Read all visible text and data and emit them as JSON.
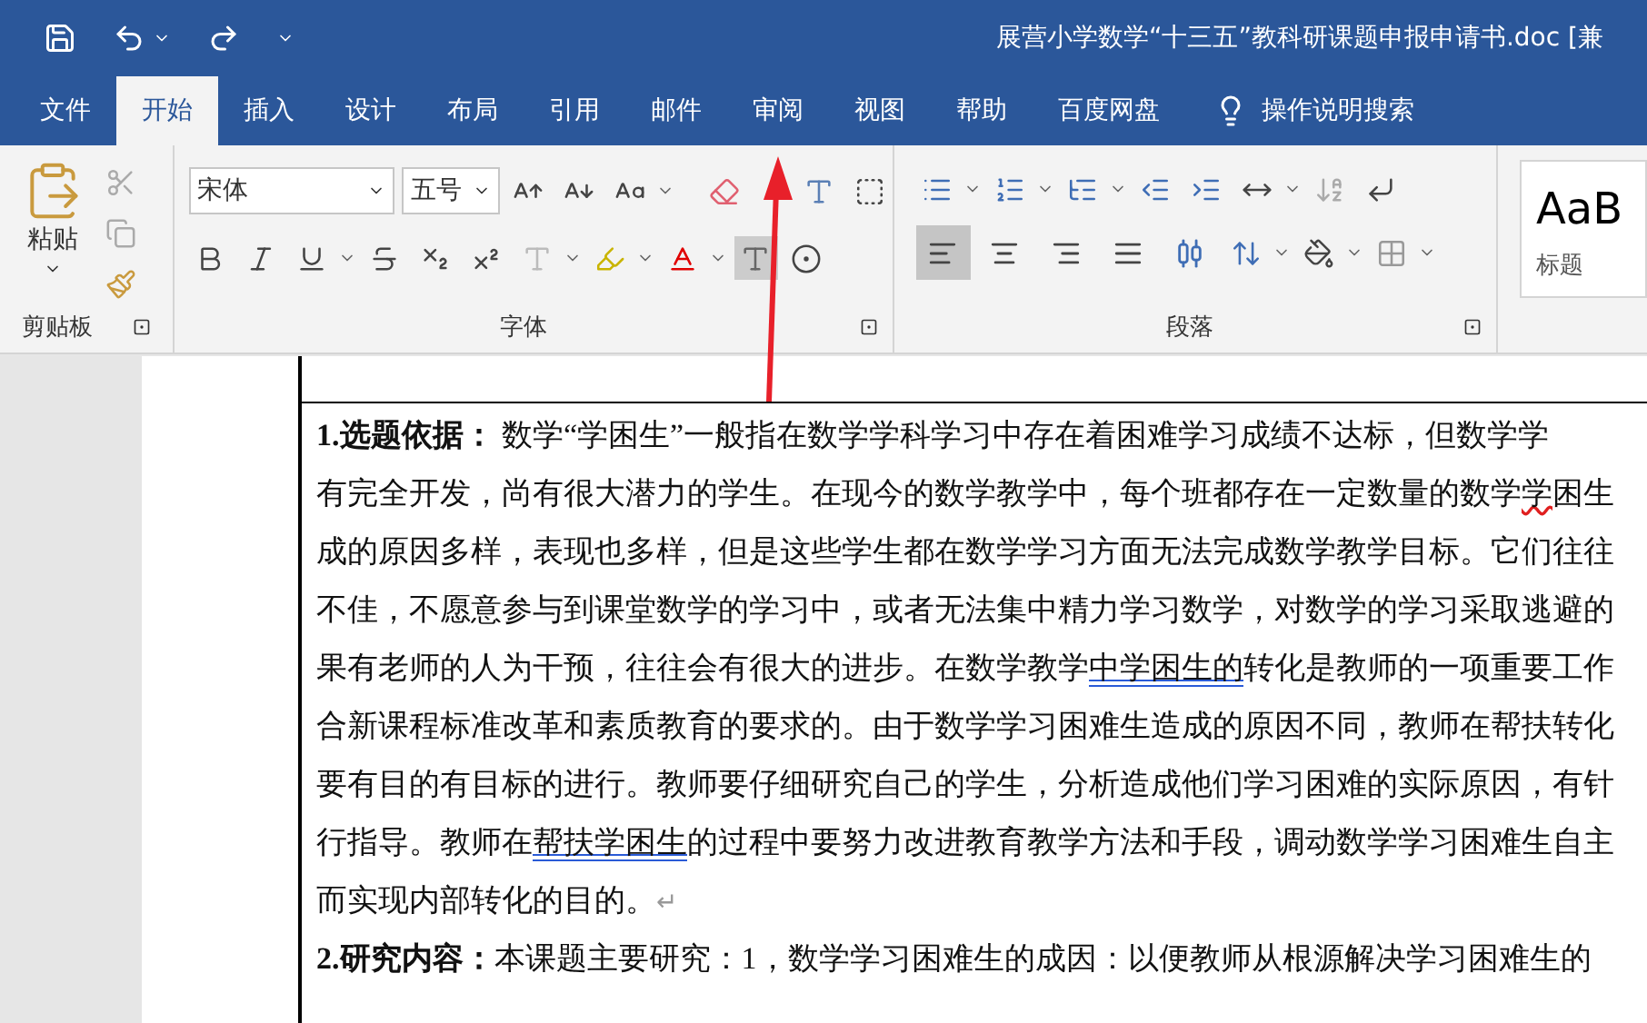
{
  "title_bar": {
    "title": "展营小学数学“十三五”教科研课题申报申请书.doc [兼"
  },
  "tabs": [
    {
      "label": "文件",
      "selected": false
    },
    {
      "label": "开始",
      "selected": true
    },
    {
      "label": "插入",
      "selected": false
    },
    {
      "label": "设计",
      "selected": false
    },
    {
      "label": "布局",
      "selected": false
    },
    {
      "label": "引用",
      "selected": false
    },
    {
      "label": "邮件",
      "selected": false
    },
    {
      "label": "审阅",
      "selected": false
    },
    {
      "label": "视图",
      "selected": false
    },
    {
      "label": "帮助",
      "selected": false
    },
    {
      "label": "百度网盘",
      "selected": false
    }
  ],
  "tell_me": "操作说明搜索",
  "ribbon": {
    "clipboard": {
      "paste": "粘贴",
      "label": "剪贴板"
    },
    "font": {
      "font_name": "宋体",
      "font_size": "五号",
      "label": "字体"
    },
    "paragraph": {
      "label": "段落",
      "alignments": [
        {
          "kind": "left",
          "selected": true
        },
        {
          "kind": "center",
          "selected": false
        },
        {
          "kind": "right",
          "selected": false
        },
        {
          "kind": "justify",
          "selected": false
        },
        {
          "kind": "distributed",
          "selected": false
        }
      ]
    },
    "styles": {
      "preview": "AaB",
      "label": "标题"
    }
  },
  "document": {
    "lines": [
      {
        "segments": [
          {
            "kind": "bold",
            "text": "1.选题依据："
          },
          {
            "kind": "plain",
            "text": "   数学“学困生”一般指在数学学科学习中存在着困难学习成绩不达标，但数学学"
          }
        ]
      },
      {
        "segments": [
          {
            "kind": "plain",
            "text": "有完全开发，尚有很大潜力的学生。在现今的数学教学中，每个班都存在一定数量的数学"
          },
          {
            "kind": "spelling",
            "text": "学"
          },
          {
            "kind": "plain",
            "text": "困生"
          }
        ]
      },
      {
        "segments": [
          {
            "kind": "plain",
            "text": "成的原因多样，表现也多样，但是这些学生都在数学学习方面无法完成数学教学目标。它们往往"
          }
        ]
      },
      {
        "segments": [
          {
            "kind": "plain",
            "text": "不佳，不愿意参与到课堂数学的学习中，或者无法集中精力学习数学，对数学的学习采取逃避的"
          }
        ]
      },
      {
        "segments": [
          {
            "kind": "plain",
            "text": "果有老师的人为干预，往往会有很大的进步。在数学教学"
          },
          {
            "kind": "grammar",
            "text": "中学困生的"
          },
          {
            "kind": "plain",
            "text": "转化是教师的一项重要工作"
          }
        ]
      },
      {
        "segments": [
          {
            "kind": "plain",
            "text": "合新课程标准改革和素质教育的要求的。由于数学学习困难生造成的原因不同，教师在帮扶转化"
          }
        ]
      },
      {
        "segments": [
          {
            "kind": "plain",
            "text": "要有目的有目标的进行。教师要仔细研究自己的学生，分析造成他们学习困难的实际原因，有针"
          }
        ]
      },
      {
        "segments": [
          {
            "kind": "plain",
            "text": "行指导。教师在"
          },
          {
            "kind": "grammar",
            "text": "帮扶学困生"
          },
          {
            "kind": "plain",
            "text": "的过程中要努力改进教育教学方法和手段，调动数学学习困难生自主"
          }
        ]
      },
      {
        "segments": [
          {
            "kind": "plain",
            "text": "而实现内部转化的目的。"
          },
          {
            "kind": "mark",
            "text": "↵"
          }
        ]
      },
      {
        "segments": [
          {
            "kind": "bold",
            "text": "2.研究内容："
          },
          {
            "kind": "plain",
            "text": "本课题主要研究：1，数学学习困难生的成因：以便教师从根源解决学习困难生的"
          }
        ]
      }
    ]
  }
}
